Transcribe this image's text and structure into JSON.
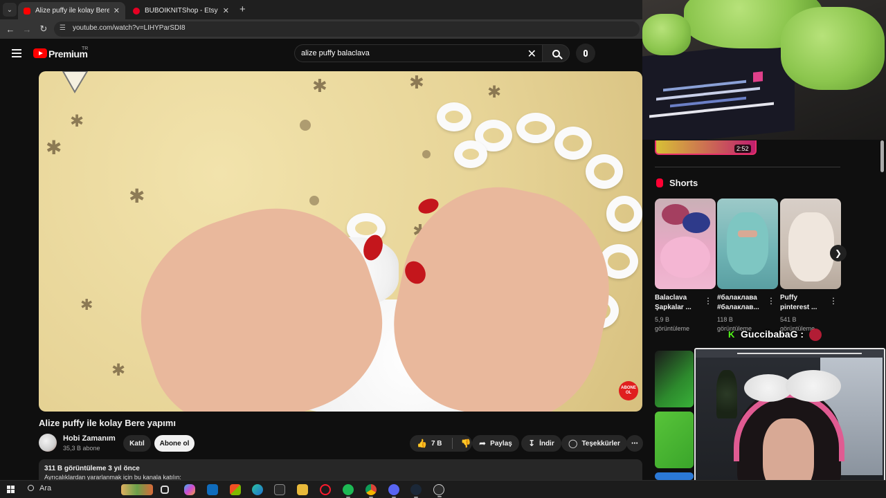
{
  "browser": {
    "tabs": [
      {
        "title": "Alize puffy ile kolay Bere yapımı",
        "favicon_color": "#ff0000",
        "active": true
      },
      {
        "title": "BUBOIKNITShop - Etsy",
        "favicon_color": "#e60023",
        "active": false
      }
    ],
    "url": "youtube.com/watch?v=LIHYParSDI8"
  },
  "youtube": {
    "brand": "Premium",
    "region": "TR",
    "search_value": "alize puffy balaclava",
    "video": {
      "title": "Alize puffy ile kolay Bere yapımı",
      "watermark": "ABONE OL",
      "channel": {
        "name": "Hobi Zamanım",
        "subscribers": "35,3 B abone"
      },
      "join_label": "Katıl",
      "subscribe_label": "Abone ol",
      "likes": "7 B",
      "share_label": "Paylaş",
      "download_label": "İndir",
      "thanks_label": "Teşekkürler",
      "views_line": "311 B görüntüleme  3 yıl önce",
      "description_line": "Ayrıcalıklardan yararlanmak için bu kanala katılın:"
    },
    "sidebar": {
      "top_duration": "2:52",
      "shorts_heading": "Shorts",
      "shorts": [
        {
          "title_l1": "Balaclava",
          "title_l2": "Şapkalar ...",
          "views_l1": "5,9 B",
          "views_l2": "görüntüleme"
        },
        {
          "title_l1": "#балаклава",
          "title_l2": "#балаклав...",
          "views_l1": "118 B",
          "views_l2": "görüntüleme"
        },
        {
          "title_l1": "Puffy",
          "title_l2": "pinterest ...",
          "views_l1": "541 B",
          "views_l2": "görüntüleme"
        }
      ]
    }
  },
  "overlay": {
    "chat_user": "GuccibabaG :",
    "chat_platform_glyph": "K"
  },
  "taskbar": {
    "search_label": "Ara"
  },
  "colors": {
    "accent": "#ff0000",
    "background": "#0f0f0f",
    "chat_platform": "#53fc18"
  }
}
